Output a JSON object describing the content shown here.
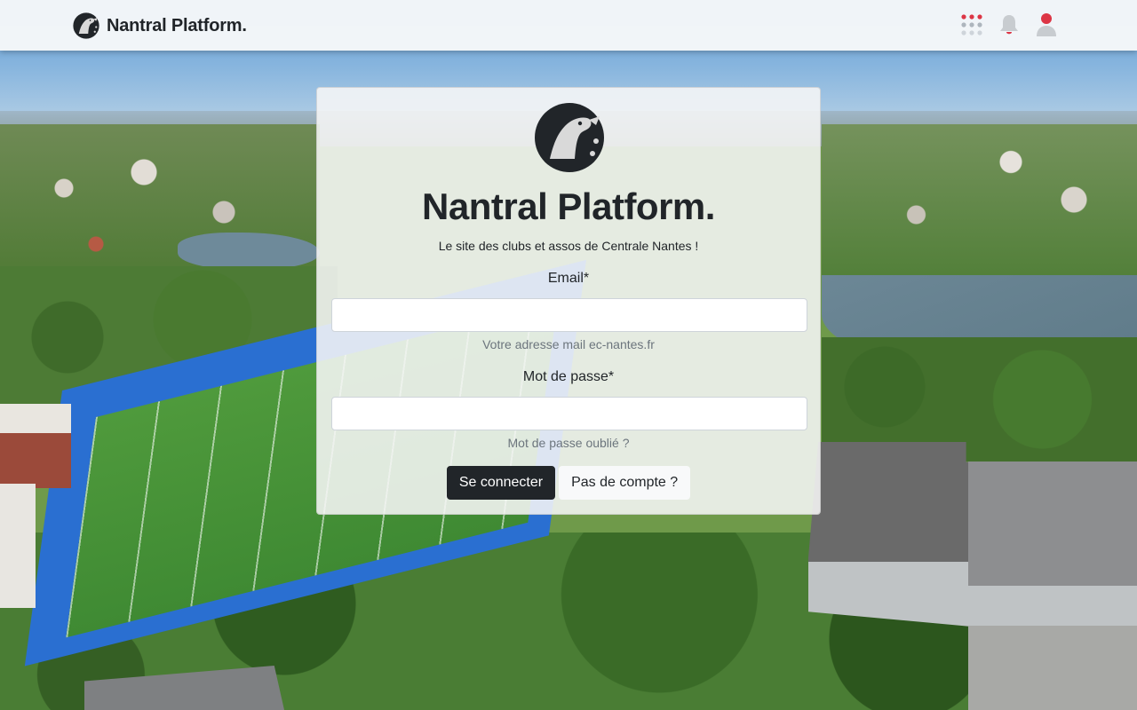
{
  "navbar": {
    "brand_name": "Nantral Platform.",
    "icons": {
      "brand": "nantral-logo-icon",
      "apps": "apps-grid-icon",
      "notifications": "bell-icon",
      "profile": "user-icon"
    }
  },
  "login": {
    "title": "Nantral Platform.",
    "subtitle": "Le site des clubs et assos de Centrale Nantes !",
    "email": {
      "label": "Email*",
      "value": "",
      "help": "Votre adresse mail ec-nantes.fr"
    },
    "password": {
      "label": "Mot de passe*",
      "value": "",
      "help": "Mot de passe oublié ?"
    },
    "submit_label": "Se connecter",
    "register_label": "Pas de compte ?"
  },
  "colors": {
    "brand_dark": "#212529",
    "accent_red": "#dc3545",
    "icon_grey": "#adb5bd"
  }
}
